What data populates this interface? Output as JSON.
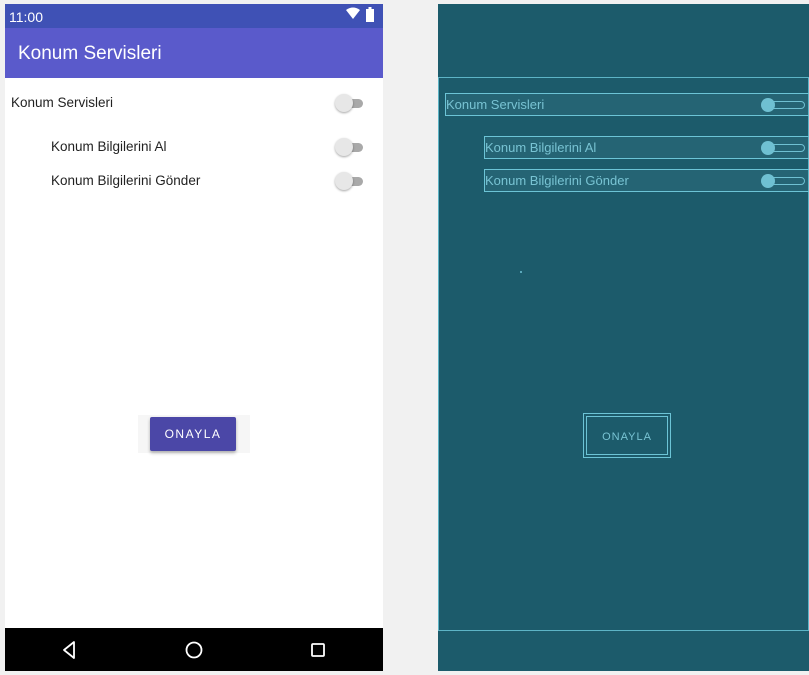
{
  "status_bar": {
    "time": "11:00",
    "icons": [
      "wifi-icon",
      "battery-icon"
    ]
  },
  "app_bar": {
    "title": "Konum Servisleri"
  },
  "settings": {
    "main_label": "Konum Servisleri",
    "main_enabled": false,
    "sub_items": [
      {
        "label": "Konum Bilgilerini Al",
        "enabled": false
      },
      {
        "label": "Konum Bilgilerini Gönder",
        "enabled": false
      }
    ]
  },
  "confirm_button": {
    "label": "ONAYLA"
  },
  "nav_bar": {
    "buttons": [
      "back-icon",
      "home-icon",
      "recents-icon"
    ]
  },
  "blueprint": {
    "main_label": "Konum Servisleri",
    "sub_labels": [
      "Konum Bilgilerini Al",
      "Konum Bilgilerini Gönder"
    ],
    "button_label": "ONAYLA"
  },
  "colors": {
    "primary": "#3f51b5",
    "app_bar": "#5a5acb",
    "button": "#4b47a7",
    "blueprint_bg": "#1c5b6b",
    "blueprint_line": "#6cc4d6"
  }
}
